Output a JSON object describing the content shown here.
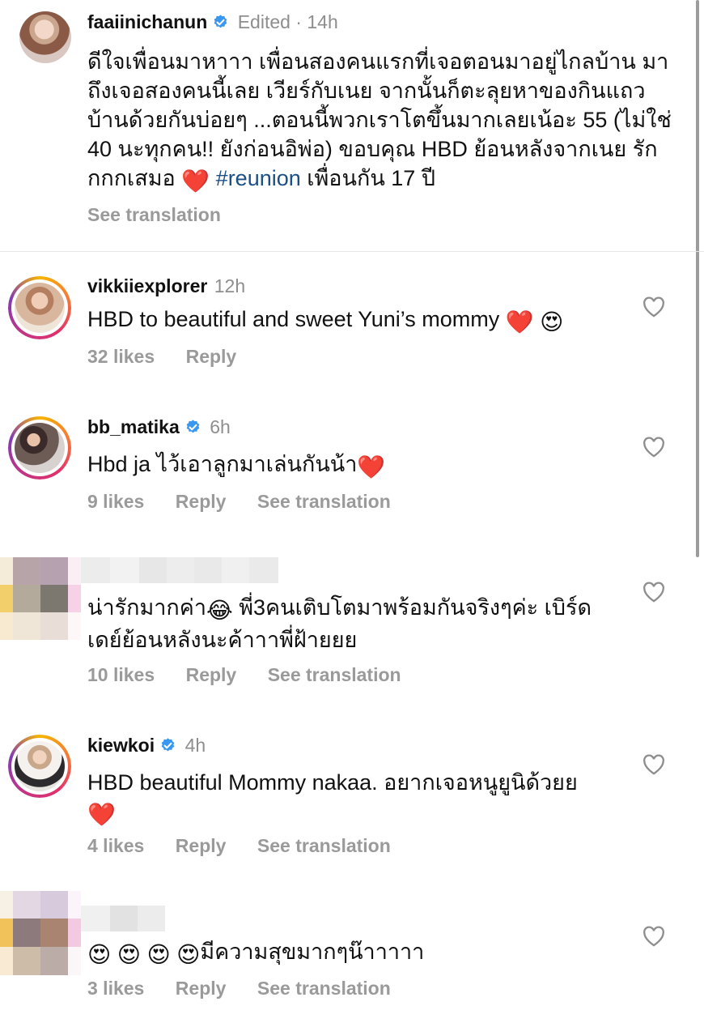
{
  "caption": {
    "username": "faaiinichanun",
    "edited": "Edited · 14h",
    "text_lines": [
      "ดีใจเพื่อนมาหาาา เพื่อนสองคนแรกที่เจอตอนมาอยู่ไกลบ้าน มา",
      "ถึงเจอสองคนนี้เลย เวียร์กับเนย จากนั้นก็ตะลุยหาของกินแถว",
      "บ้านด้วยกันบ่อยๆ ...ตอนนี้พวกเราโตขึ้นมากเลยเน้อะ 55 (ไม่ใช่",
      "40 นะทุกคน!! ยังก่อนอิพ่อ) ขอบคุณ HBD ย้อนหลังจากเนย รัก"
    ],
    "last_line_before": "กกกเสมอ",
    "hashtag": "#reunion",
    "last_line_after": "เพื่อนกัน 17 ปี",
    "see_translation": "See translation"
  },
  "comments": [
    {
      "username": "vikkiiexplorer",
      "time": "12h",
      "text": "HBD to beautiful and sweet Yuni’s mommy",
      "likes": "32 likes",
      "reply": "Reply"
    },
    {
      "username": "bb_matika",
      "time": "6h",
      "text": "Hbd ja ไว้เอาลูกมาเล่นกันน้า",
      "likes": "9 likes",
      "reply": "Reply",
      "see_translation": "See translation"
    },
    {
      "text_a": "น่ารักมากค่า",
      "text_b": "พี่3คนเติบโตมาพร้อมกันจริงๆค่ะ เบิร์ด",
      "text_line2": "เดย์ย้อนหลังนะค้าาาพี่ฝ้ายยย",
      "likes": "10 likes",
      "reply": "Reply",
      "see_translation": "See translation"
    },
    {
      "username": "kiewkoi",
      "time": "4h",
      "text": "HBD beautiful Mommy nakaa. อยากเจอหนูยูนิด้วยย",
      "likes": "4 likes",
      "reply": "Reply",
      "see_translation": "See translation"
    },
    {
      "text": "มีความสุขมากๆน๊าาาาา",
      "likes": "3 likes",
      "reply": "Reply",
      "see_translation": "See translation"
    }
  ],
  "emoji": {
    "red_heart": "❤️",
    "heart_eyes": "😍",
    "tears_of_joy": "😂"
  },
  "colors": {
    "verified_blue": "#3897f0",
    "hashtag": "#1b4f88",
    "muted": "#9a9a9a"
  }
}
